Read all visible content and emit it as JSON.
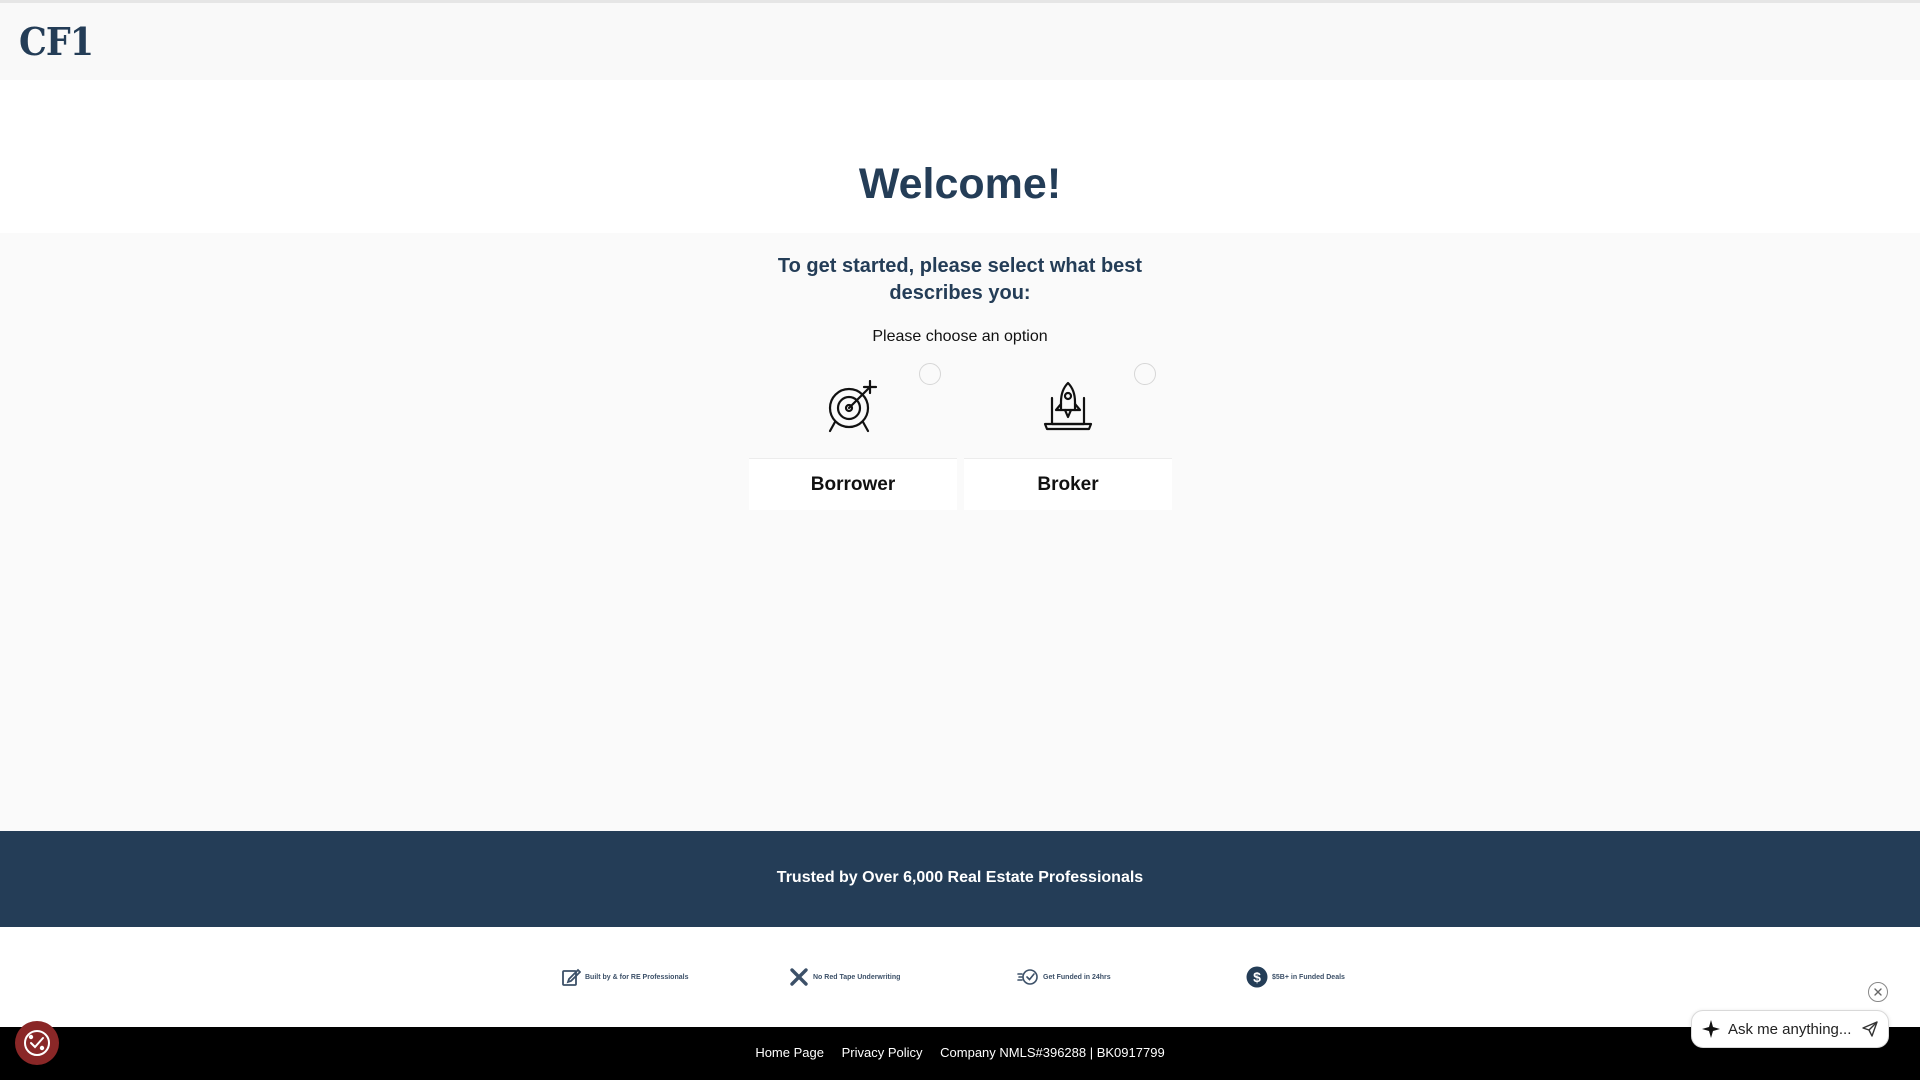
{
  "header": {
    "logo_text": "CF1"
  },
  "main": {
    "title": "Welcome!",
    "subtitle": "To get started, please select what best describes you:",
    "prompt": "Please choose an option",
    "options": [
      {
        "label": "Borrower",
        "icon": "target-arrow-icon",
        "selected": false
      },
      {
        "label": "Broker",
        "icon": "rocket-laptop-icon",
        "selected": false
      }
    ]
  },
  "trust": {
    "text": "Trusted by Over 6,000 Real Estate Professionals"
  },
  "badges": [
    {
      "text": "Built by & for RE Professionals",
      "icon": "edit-icon"
    },
    {
      "text": "No Red Tape Underwriting",
      "icon": "x-icon"
    },
    {
      "text": "Get Funded in 24hrs",
      "icon": "fast-check-icon"
    },
    {
      "text": "$5B+ in Funded Deals",
      "icon": "dollar-icon"
    }
  ],
  "footer": {
    "links": [
      "Home Page",
      "Privacy Policy",
      "Company NMLS#396288 | BK0917799"
    ]
  },
  "chat": {
    "placeholder": "Ask me anything..."
  },
  "colors": {
    "brand": "#243d57",
    "cookie": "#8a2727"
  }
}
